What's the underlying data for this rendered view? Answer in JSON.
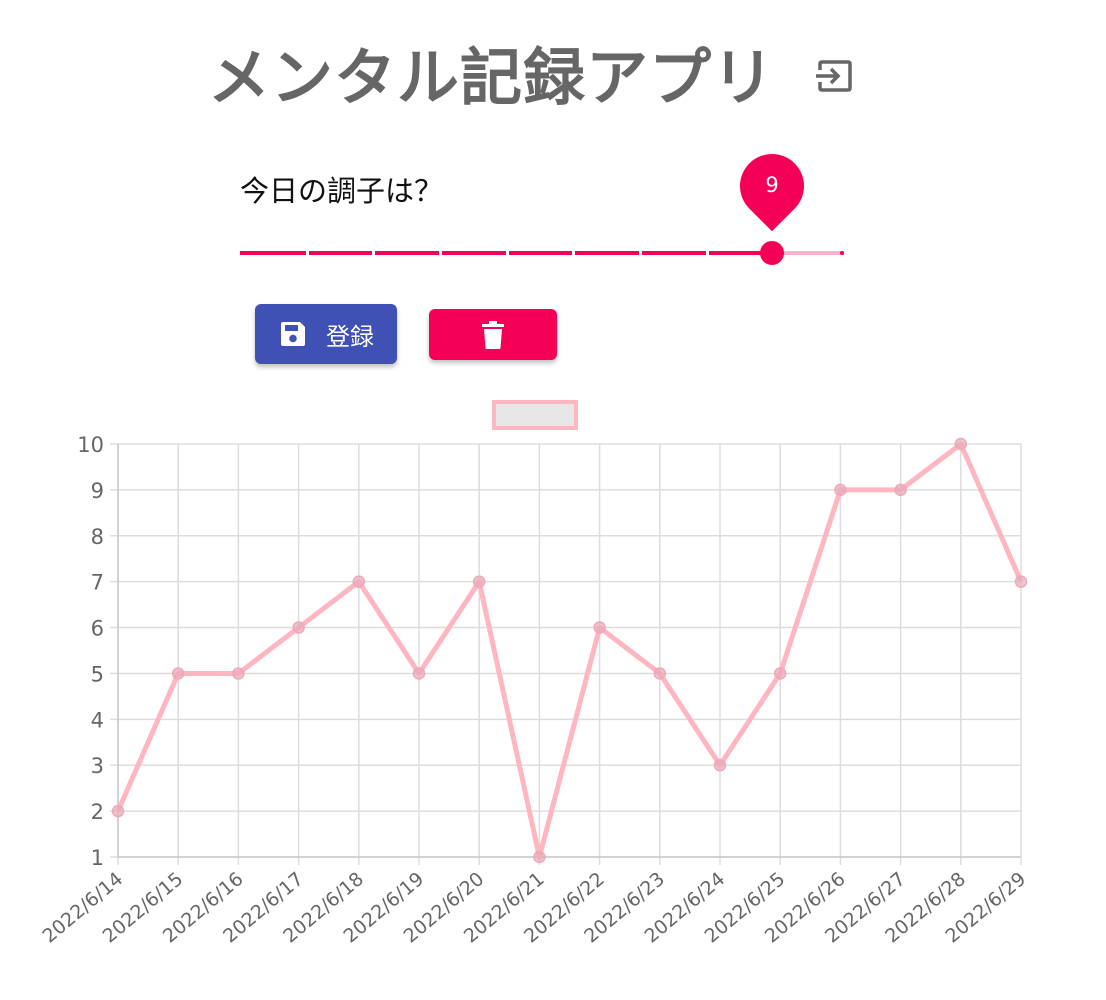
{
  "header": {
    "title": "メンタル記録アプリ",
    "logout_icon": "logout-icon"
  },
  "mood": {
    "question": "今日の調子は？",
    "slider": {
      "min": 1,
      "max": 10,
      "value": 9,
      "value_label": "9"
    }
  },
  "actions": {
    "save": {
      "label": "登録",
      "icon": "save-icon"
    },
    "delete": {
      "icon": "trash-icon"
    }
  },
  "colors": {
    "primary": "#3f51b5",
    "accent": "#f50057",
    "accent_light": "#f8b4c8",
    "line": "#ffb6c1",
    "title": "#666666"
  },
  "chart_data": {
    "type": "line",
    "title": "",
    "xlabel": "",
    "ylabel": "",
    "categories": [
      "2022/6/14",
      "2022/6/15",
      "2022/6/16",
      "2022/6/17",
      "2022/6/18",
      "2022/6/19",
      "2022/6/20",
      "2022/6/21",
      "2022/6/22",
      "2022/6/23",
      "2022/6/24",
      "2022/6/25",
      "2022/6/26",
      "2022/6/27",
      "2022/6/28",
      "2022/6/29"
    ],
    "series": [
      {
        "values": [
          2,
          5,
          5,
          6,
          7,
          5,
          7,
          1,
          6,
          5,
          3,
          5,
          9,
          9,
          10,
          7
        ]
      }
    ],
    "ylim": [
      1,
      10
    ],
    "yticks": [
      1,
      2,
      3,
      4,
      5,
      6,
      7,
      8,
      9,
      10
    ],
    "grid": true,
    "legend": "top",
    "legend_label": ""
  }
}
